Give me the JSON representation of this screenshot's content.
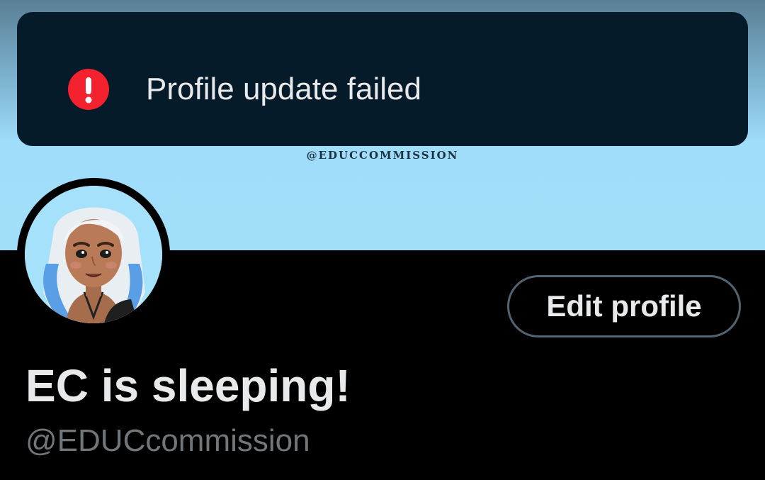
{
  "banner": {
    "watermark": "@EDUCCOMMISSION",
    "color": "#a0defa"
  },
  "toast": {
    "icon": "alert-circle-icon",
    "message": "Profile update failed",
    "background": "#061b29",
    "icon_color": "#f4212e"
  },
  "profile": {
    "avatar": "illustrated-avatar",
    "edit_button_label": "Edit profile",
    "display_name": "EC is sleeping!",
    "handle": "@EDUCcommission"
  }
}
